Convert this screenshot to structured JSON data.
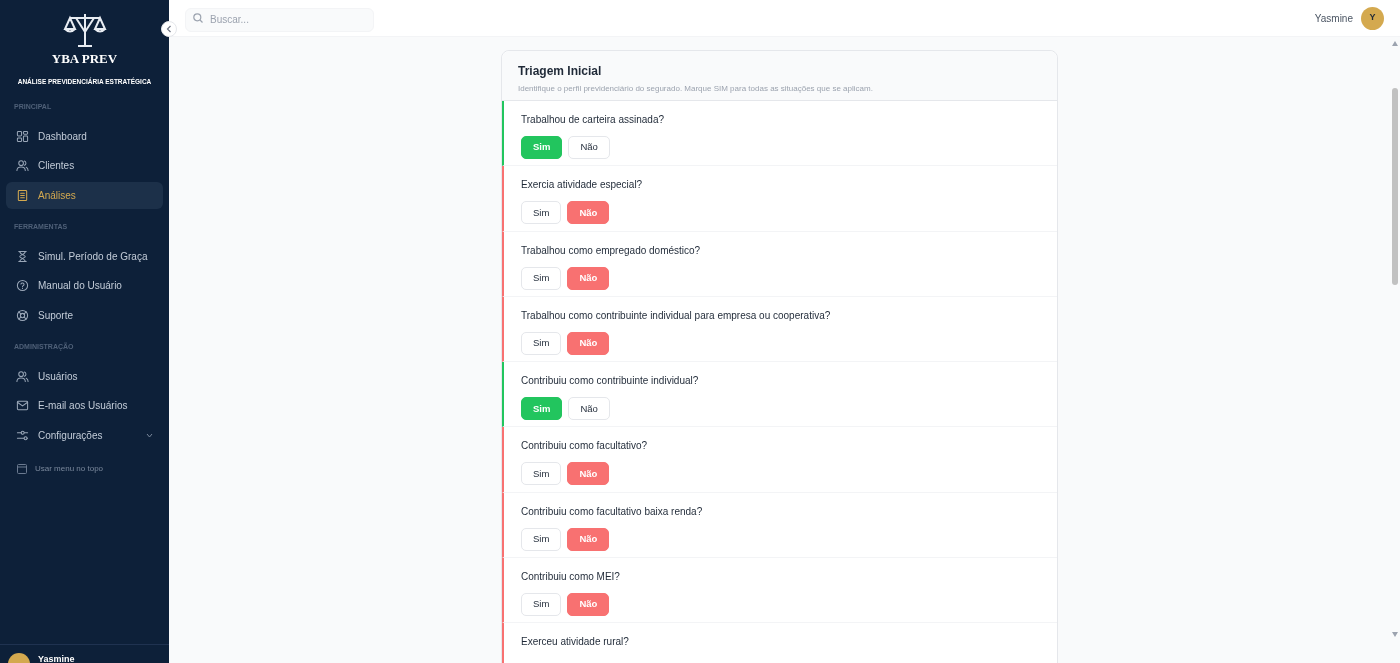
{
  "brand": {
    "name": "YBA PREV",
    "tagline": "ANÁLISE PREVIDENCIÁRIA ESTRATÉGICA"
  },
  "sidebar": {
    "sections": [
      {
        "title": "PRINCIPAL",
        "items": [
          {
            "label": "Dashboard",
            "kind": "grid",
            "selected": false
          },
          {
            "label": "Clientes",
            "kind": "users",
            "selected": false
          },
          {
            "label": "Análises",
            "kind": "clipboard",
            "selected": true
          }
        ]
      },
      {
        "title": "FERRAMENTAS",
        "items": [
          {
            "label": "Simul. Período de Graça",
            "kind": "hourglass",
            "selected": false
          },
          {
            "label": "Manual do Usuário",
            "kind": "help",
            "selected": false
          },
          {
            "label": "Suporte",
            "kind": "lifebuoy",
            "selected": false
          }
        ]
      },
      {
        "title": "ADMINISTRAÇÃO",
        "items": [
          {
            "label": "Usuários",
            "kind": "users",
            "selected": false
          },
          {
            "label": "E-mail aos Usuários",
            "kind": "mail",
            "selected": false
          },
          {
            "label": "Configurações",
            "kind": "sliders",
            "selected": false,
            "expanded": false
          }
        ]
      }
    ],
    "layout_toggle": "Usar menu no topo",
    "user": {
      "name": "Yasmine"
    }
  },
  "search": {
    "placeholder": "Buscar..."
  },
  "header_user": {
    "name": "Yasmine",
    "initial": "Y"
  },
  "card": {
    "title": "Triagem Inicial",
    "subtitle": "Identifique o perfil previdenciário do segurado. Marque SIM para todas as situações que se aplicam.",
    "questions": [
      {
        "text": "Trabalhou de carteira assinada?",
        "options": [
          {
            "label": "Sim",
            "kind": "yes",
            "selected": true
          },
          {
            "label": "Não",
            "kind": "no",
            "selected": false
          }
        ]
      },
      {
        "text": "Exercia atividade especial?",
        "options": [
          {
            "label": "Sim",
            "kind": "yes",
            "selected": false
          },
          {
            "label": "Não",
            "kind": "no",
            "selected": true
          }
        ]
      },
      {
        "text": "Trabalhou como empregado doméstico?",
        "options": [
          {
            "label": "Sim",
            "kind": "yes",
            "selected": false
          },
          {
            "label": "Não",
            "kind": "no",
            "selected": true
          }
        ]
      },
      {
        "text": "Trabalhou como contribuinte individual para empresa ou cooperativa?",
        "options": [
          {
            "label": "Sim",
            "kind": "yes",
            "selected": false
          },
          {
            "label": "Não",
            "kind": "no",
            "selected": true
          }
        ]
      },
      {
        "text": "Contribuiu como contribuinte individual?",
        "options": [
          {
            "label": "Sim",
            "kind": "yes",
            "selected": true
          },
          {
            "label": "Não",
            "kind": "no",
            "selected": false
          }
        ]
      },
      {
        "text": "Contribuiu como facultativo?",
        "options": [
          {
            "label": "Sim",
            "kind": "yes",
            "selected": false
          },
          {
            "label": "Não",
            "kind": "no",
            "selected": true
          }
        ]
      },
      {
        "text": "Contribuiu como facultativo baixa renda?",
        "options": [
          {
            "label": "Sim",
            "kind": "yes",
            "selected": false
          },
          {
            "label": "Não",
            "kind": "no",
            "selected": true
          }
        ]
      },
      {
        "text": "Contribuiu como MEI?",
        "options": [
          {
            "label": "Sim",
            "kind": "yes",
            "selected": false
          },
          {
            "label": "Não",
            "kind": "no",
            "selected": true
          }
        ]
      },
      {
        "text": "Exerceu atividade rural?"
      }
    ]
  }
}
